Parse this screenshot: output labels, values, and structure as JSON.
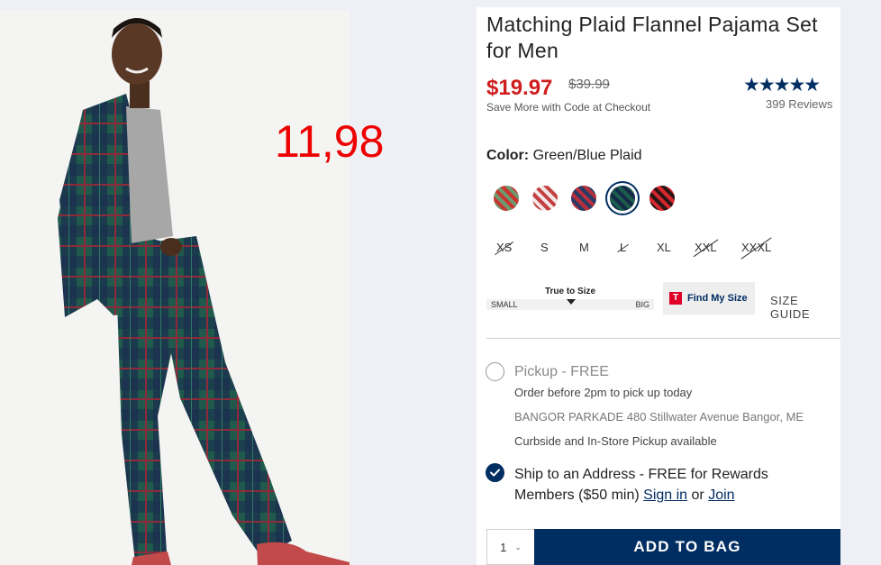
{
  "overlay": {
    "handwritten_price": "11,98"
  },
  "product": {
    "title": "Matching Plaid Flannel Pajama Set for Men",
    "sale_price": "$19.97",
    "original_price": "$39.99",
    "promo": "Save More with Code at Checkout",
    "rating_stars": "★★★★★",
    "reviews": "399 Reviews"
  },
  "color": {
    "label": "Color:",
    "selected": "Green/Blue Plaid",
    "swatches": [
      {
        "name": "red-green-plaid",
        "colors": [
          "#c8352f",
          "#6e9a72"
        ]
      },
      {
        "name": "red-white-plaid",
        "colors": [
          "#f3e6e6",
          "#c44040"
        ]
      },
      {
        "name": "navy-red-plaid",
        "colors": [
          "#2a3a66",
          "#b5303a"
        ]
      },
      {
        "name": "green-blue-plaid",
        "colors": [
          "#1c5c4c",
          "#142a48"
        ],
        "selected": true
      },
      {
        "name": "red-black-plaid",
        "colors": [
          "#d7262e",
          "#2a1414"
        ]
      }
    ]
  },
  "sizes": [
    {
      "label": "XS",
      "available": false
    },
    {
      "label": "S",
      "available": true
    },
    {
      "label": "M",
      "available": true
    },
    {
      "label": "L",
      "available": false
    },
    {
      "label": "XL",
      "available": true
    },
    {
      "label": "XXL",
      "available": false
    },
    {
      "label": "XXXL",
      "available": false
    }
  ],
  "fit": {
    "title": "True to Size",
    "small": "SMALL",
    "big": "BIG"
  },
  "find_size": {
    "icon_letter": "T",
    "label": "Find My Size"
  },
  "size_guide": "SIZE GUIDE",
  "pickup": {
    "title": "Pickup - FREE",
    "order_before": "Order before 2pm to pick up today",
    "store_name": "BANGOR PARKADE",
    "store_address": "480 Stillwater Avenue  Bangor, ME",
    "availability": "Curbside and In-Store Pickup available",
    "selected": false
  },
  "ship": {
    "text": "Ship to an Address - FREE for Rewards Members ($50 min)",
    "sign_in": "Sign in",
    "or": "or",
    "join": "Join",
    "selected": true
  },
  "quantity": "1",
  "add_to_bag": "ADD TO BAG",
  "colors": {
    "brand_navy": "#002d62",
    "sale_red": "#d01e1e",
    "overlay_red": "#ee0000"
  }
}
